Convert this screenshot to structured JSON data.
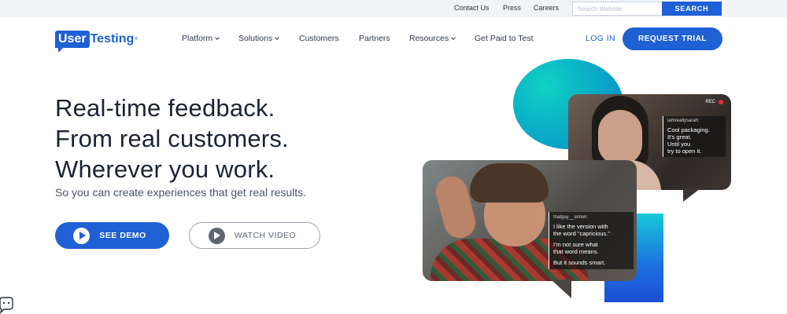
{
  "utility": {
    "links": [
      "Contact Us",
      "Press",
      "Careers"
    ],
    "search_placeholder": "Search Website",
    "search_button": "SEARCH"
  },
  "nav": {
    "logo_box": "User",
    "logo_text": "Testing",
    "logo_mark": "®",
    "items": [
      {
        "label": "Platform"
      },
      {
        "label": "Solutions"
      },
      {
        "label": "Customers"
      },
      {
        "label": "Partners"
      },
      {
        "label": "Resources"
      },
      {
        "label": "Get Paid to Test"
      }
    ],
    "login": "LOG IN",
    "cta": "REQUEST TRIAL"
  },
  "hero": {
    "headline": [
      "Real-time feedback.",
      "From real customers.",
      "Wherever you work."
    ],
    "subhead": "So you can create experiences that get real results.",
    "demo_button": "SEE DEMO",
    "video_button": "WATCH VIDEO"
  },
  "cards": {
    "top": {
      "rec": "REC",
      "user": "iamreallysarah:",
      "lines": [
        "Cool packaging.",
        "It's great.",
        "Until you",
        "try to open it."
      ]
    },
    "bottom": {
      "user": "thatguy__simon:",
      "lines": [
        "I like the version with",
        "the word \"capricious.\""
      ],
      "lines2": [
        "I'm not sure what",
        "that word means."
      ],
      "lines3": [
        "But it sounds smart."
      ]
    }
  },
  "colors": {
    "brand_blue": "#1f60d4",
    "teal": "#0fd2c4",
    "text_dark": "#1b2334"
  }
}
